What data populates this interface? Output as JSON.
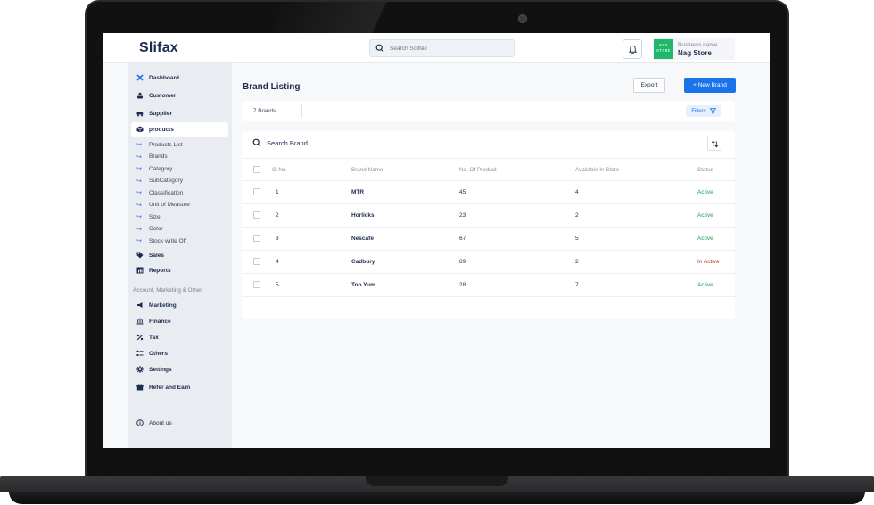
{
  "app": {
    "logo": "Slifax",
    "search_placeholder": "Search Sollfax",
    "business": {
      "label": "Business name",
      "name": "Nag Store",
      "logo_line1": "NAG",
      "logo_line2": "STORE"
    }
  },
  "sidebar": {
    "items_top": [
      {
        "label": "Dashboard",
        "icon": "dashboard-x-icon"
      },
      {
        "label": "Customer",
        "icon": "customer-icon"
      },
      {
        "label": "Supplier",
        "icon": "truck-icon"
      },
      {
        "label": "products",
        "icon": "box-icon"
      }
    ],
    "products_sub": [
      "Products List",
      "Brands",
      "Category",
      "SubCategory",
      "Classification",
      "Unit of Measure",
      "Size",
      "Color",
      "Stock write Off"
    ],
    "items_mid": [
      {
        "label": "Sales",
        "icon": "tag-icon"
      },
      {
        "label": "Reports",
        "icon": "chart-icon"
      }
    ],
    "section_label": "Account, Marketing & Other",
    "items_bottom": [
      {
        "label": "Marketing",
        "icon": "megaphone-icon"
      },
      {
        "label": "Finance",
        "icon": "bank-icon"
      },
      {
        "label": "Tax",
        "icon": "percent-icon"
      },
      {
        "label": "Others",
        "icon": "list-icon"
      },
      {
        "label": "Settings",
        "icon": "gear-icon"
      },
      {
        "label": "Refer and Earn",
        "icon": "gift-icon"
      }
    ],
    "about": "About us"
  },
  "main": {
    "title": "Brand Listing",
    "export_label": "Export",
    "new_brand_label": "+ New Brand",
    "count_label": "7 Brands",
    "filters_label": "Filters",
    "search_label": "Search Brand",
    "columns": [
      "Sl No.",
      "Brand Name",
      "No. Of Product",
      "Available In Store",
      "Status"
    ],
    "rows": [
      {
        "sl": "1",
        "name": "MTR",
        "products": "45",
        "available": "4",
        "status": "Active"
      },
      {
        "sl": "2",
        "name": "Horlicks",
        "products": "23",
        "available": "2",
        "status": "Active"
      },
      {
        "sl": "3",
        "name": "Nescafe",
        "products": "67",
        "available": "5",
        "status": "Active"
      },
      {
        "sl": "4",
        "name": "Cadbury",
        "products": "89",
        "available": "2",
        "status": "In Active"
      },
      {
        "sl": "5",
        "name": "Too Yum",
        "products": "28",
        "available": "7",
        "status": "Active"
      }
    ],
    "colors": {
      "primary": "#1a73e8",
      "active": "#1f9d55",
      "inactive": "#c0392b"
    }
  }
}
